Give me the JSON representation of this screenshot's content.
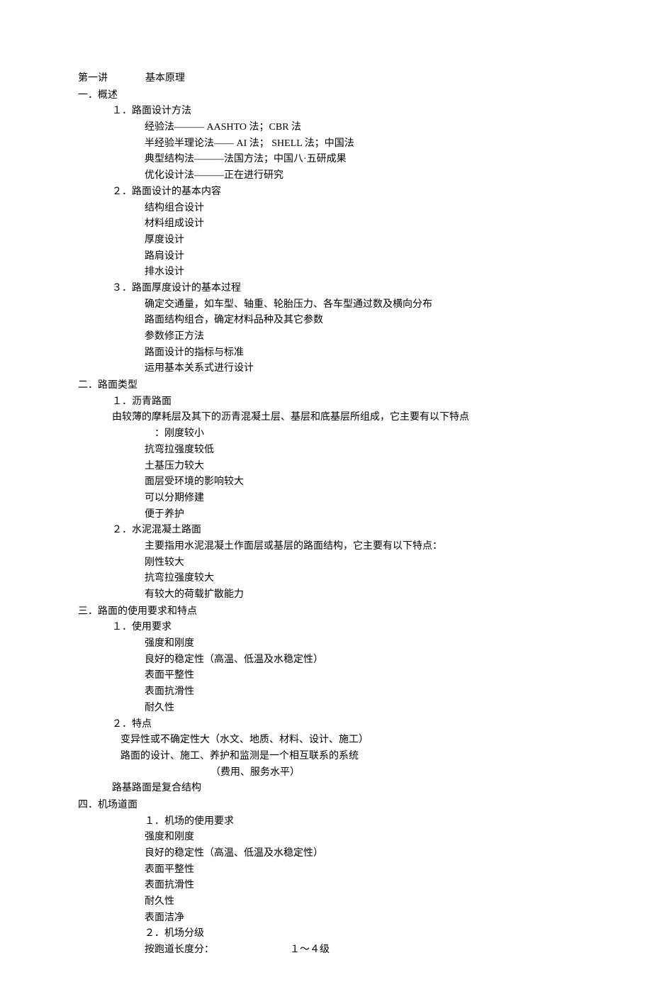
{
  "title": {
    "main": "第一讲",
    "sub": "基本原理"
  },
  "s1": {
    "h": "一．概述",
    "i1": {
      "h": "１．路面设计方法",
      "l1": "经验法———   AASHTO 法；CBR 法",
      "l2": "半经验半理论法——    AI 法； SHELL 法；中国法",
      "l3": "典型结构法———法国方法；中国八·五研成果",
      "l4": "优化设计法———正在进行研究"
    },
    "i2": {
      "h": "２．路面设计的基本内容",
      "l1": "结构组合设计",
      "l2": "材料组成设计",
      "l3": "厚度设计",
      "l4": "路肩设计",
      "l5": "排水设计"
    },
    "i3": {
      "h": "３．路面厚度设计的基本过程",
      "l1": "确定交通量，如车型、轴重、轮胎压力、各车型通过数及横向分布",
      "l2": "路面结构组合，确定材料品种及其它参数",
      "l3": "参数修正方法",
      "l4": "路面设计的指标与标准",
      "l5": "运用基本关系式进行设计"
    }
  },
  "s2": {
    "h": "二．路面类型",
    "i1": {
      "h": "１．沥青路面",
      "intro": "由较薄的摩耗层及其下的沥青混凝土层、基层和底基层所组成，它主要有以下特点",
      "intro2": "：刚度较小",
      "l2": "抗弯拉强度较低",
      "l3": "土基压力较大",
      "l4": "面层受环境的影响较大",
      "l5": "可以分期修建",
      "l6": "便于养护"
    },
    "i2": {
      "h": "２．水泥混凝土路面",
      "intro": "主要指用水泥混凝土作面层或基层的路面结构，它主要有以下特点：",
      "l1": "刚性较大",
      "l2": "抗弯拉强度较大",
      "l3": "有较大的荷载扩散能力"
    }
  },
  "s3": {
    "h": "三．路面的使用要求和特点",
    "i1": {
      "h": "１．使用要求",
      "l1": "强度和刚度",
      "l2": "良好的稳定性（高温、低温及水稳定性）",
      "l3": "表面平整性",
      "l4": "表面抗滑性",
      "l5": "耐久性"
    },
    "i2": {
      "h": "２．特点",
      "l1": "变异性或不确定性大（水文、地质、材料、设计、施工）",
      "l2": "路面的设计、施工、养护和监测是一个相互联系的系统",
      "note": "（费用、服务水平）",
      "l3": "路基路面是复合结构"
    }
  },
  "s4": {
    "h": "四．机场道面",
    "i1": {
      "h": "１．机场的使用要求",
      "l1": "强度和刚度",
      "l2": "良好的稳定性（高温、低温及水稳定性）",
      "l3": "表面平整性",
      "l4": "表面抗滑性",
      "l5": "耐久性",
      "l6": "表面洁净"
    },
    "i2": {
      "h": "２．机场分级",
      "l1a": "按跑道长度分：",
      "l1b": "１～４级"
    }
  }
}
